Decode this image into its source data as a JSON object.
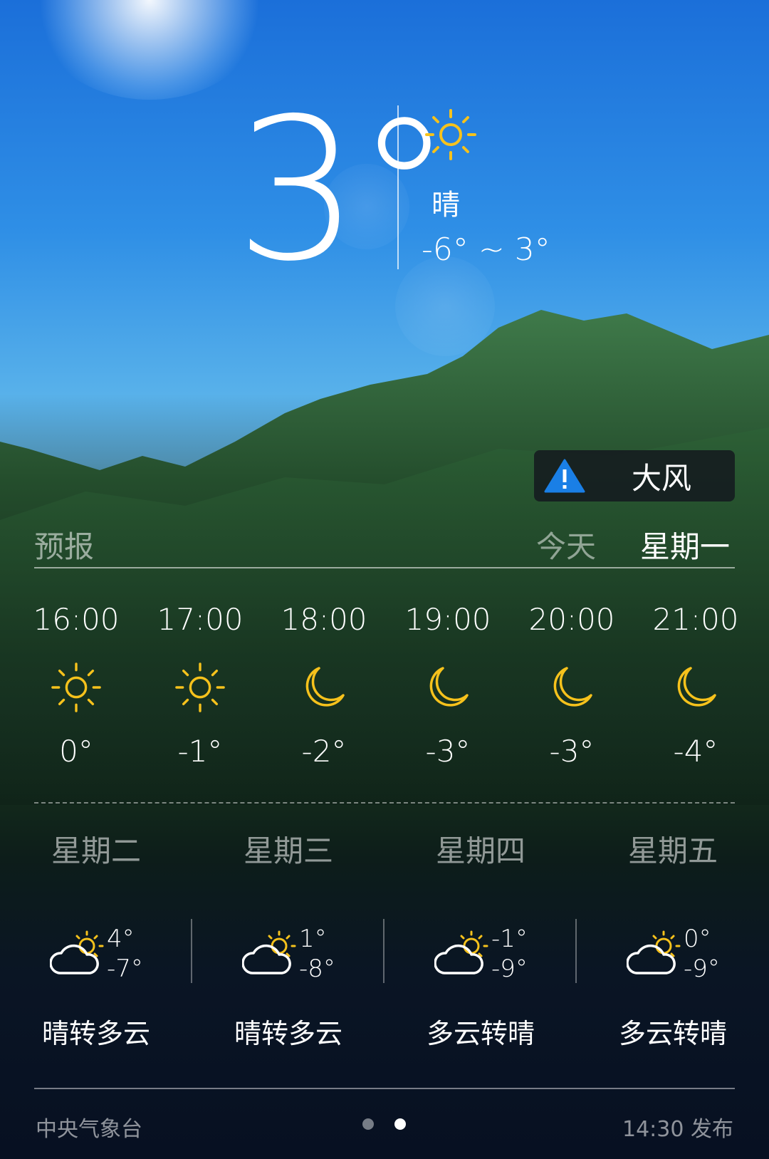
{
  "current": {
    "temperature": "3°",
    "condition": "晴",
    "condition_icon": "sun-icon",
    "range": "-6° ~ 3°"
  },
  "alert": {
    "label": "大风",
    "icon": "warning-icon",
    "color": "#1a7fe6"
  },
  "forecast_header": {
    "title": "预报",
    "tabs": [
      "今天",
      "星期一"
    ],
    "selected_tab": "星期一"
  },
  "hourly": [
    {
      "time": "16:00",
      "icon": "sun-icon",
      "temp": "0°"
    },
    {
      "time": "17:00",
      "icon": "sun-icon",
      "temp": "-1°"
    },
    {
      "time": "18:00",
      "icon": "moon-icon",
      "temp": "-2°"
    },
    {
      "time": "19:00",
      "icon": "moon-icon",
      "temp": "-3°"
    },
    {
      "time": "20:00",
      "icon": "moon-icon",
      "temp": "-3°"
    },
    {
      "time": "21:00",
      "icon": "moon-icon",
      "temp": "-4°"
    }
  ],
  "daily": [
    {
      "day": "星期二",
      "icon": "partly-cloudy-icon",
      "high": "4°",
      "low": "-7°",
      "desc": "晴转多云"
    },
    {
      "day": "星期三",
      "icon": "partly-cloudy-icon",
      "high": "1°",
      "low": "-8°",
      "desc": "晴转多云"
    },
    {
      "day": "星期四",
      "icon": "partly-cloudy-icon",
      "high": "-1°",
      "low": "-9°",
      "desc": "多云转晴"
    },
    {
      "day": "星期五",
      "icon": "partly-cloudy-icon",
      "high": "0°",
      "low": "-9°",
      "desc": "多云转晴"
    }
  ],
  "footer": {
    "source": "中央气象台",
    "publish": "14:30 发布",
    "page_count": 2,
    "active_page": 2
  },
  "colors": {
    "icon_yellow": "#f6c21c"
  }
}
